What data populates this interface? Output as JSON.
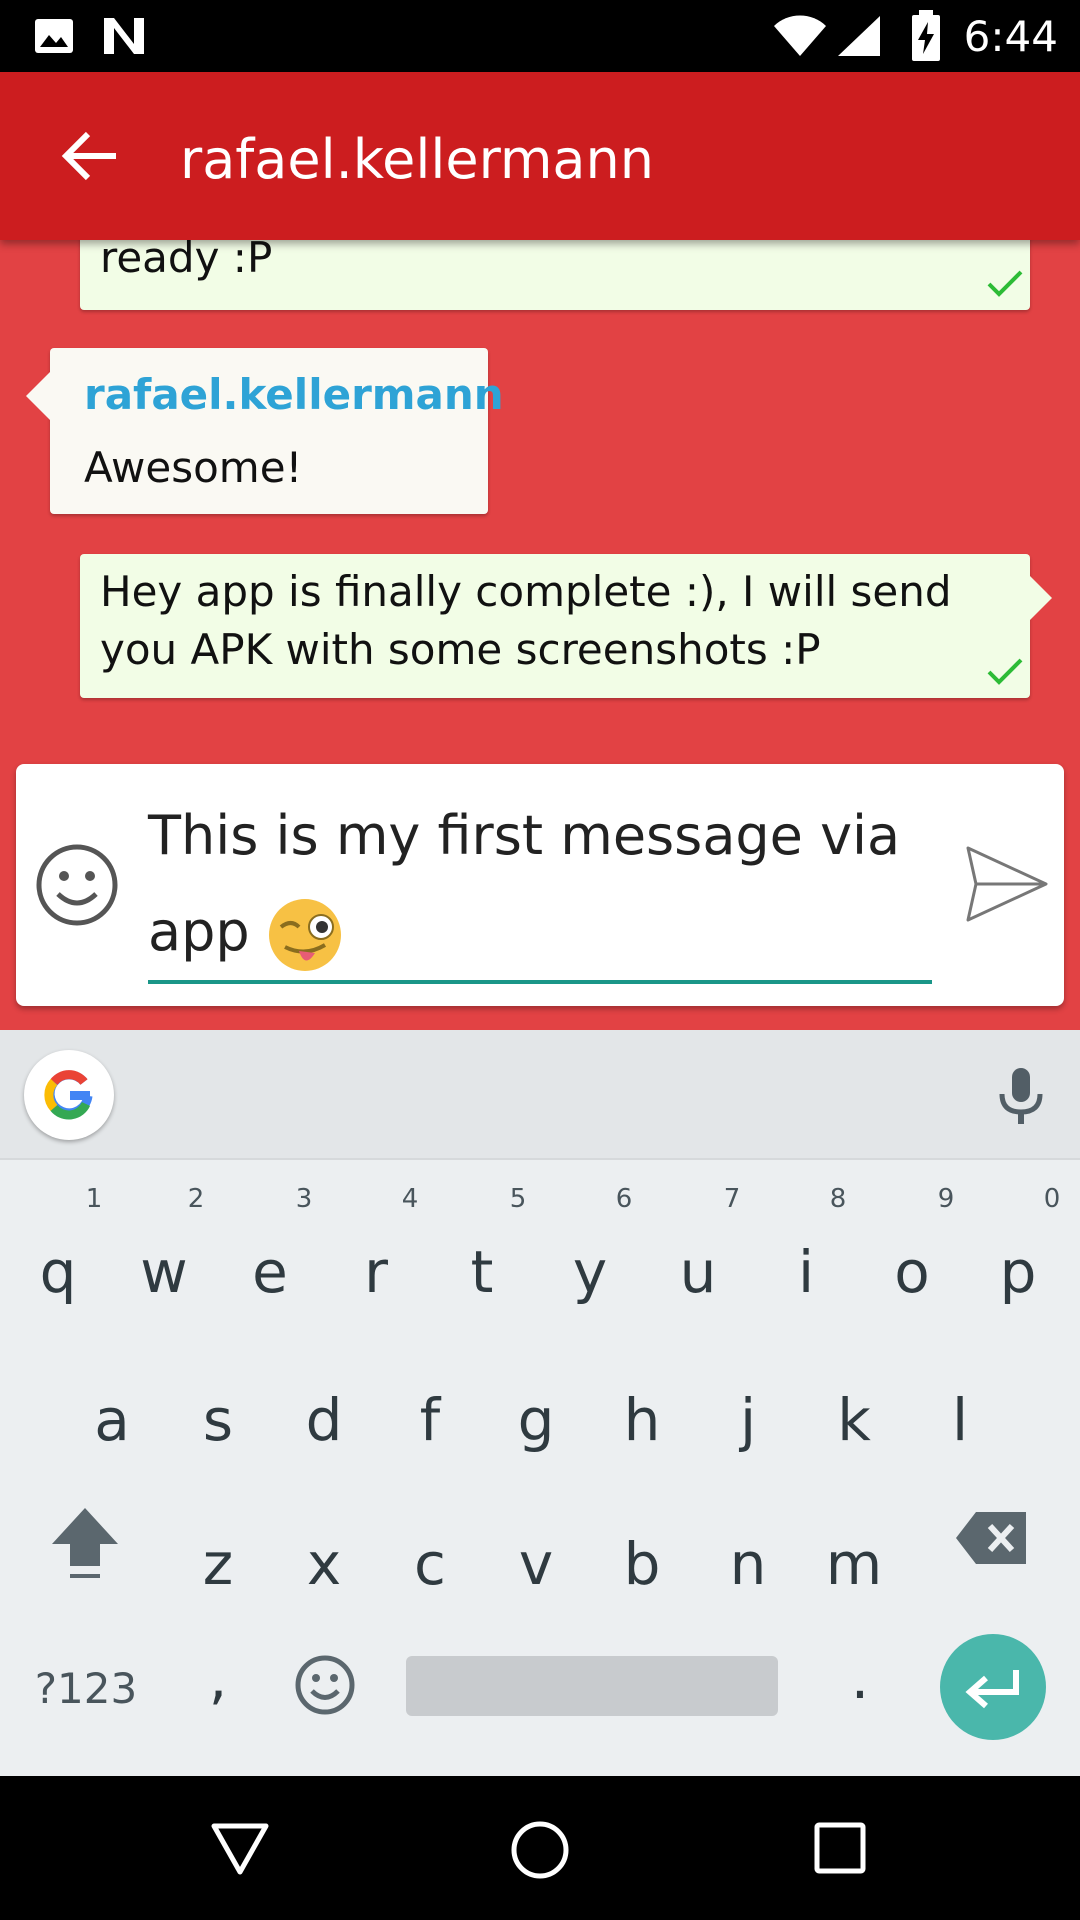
{
  "status_bar": {
    "time": "6:44"
  },
  "toolbar": {
    "title": "rafael.kellermann"
  },
  "messages": [
    {
      "direction": "out",
      "text": "ready :P"
    },
    {
      "direction": "in",
      "sender": "rafael.kellermann",
      "text": "Awesome!"
    },
    {
      "direction": "out",
      "text_line1": "Hey app is finally complete :), I will send",
      "text_line2": "you APK with some screenshots :P"
    }
  ],
  "composer": {
    "text_line1": "This is my first message via",
    "text_line2": "app",
    "emoji": "winking-face-with-tongue"
  },
  "keyboard": {
    "row1": [
      "q",
      "w",
      "e",
      "r",
      "t",
      "y",
      "u",
      "i",
      "o",
      "p"
    ],
    "row1_hints": [
      "1",
      "2",
      "3",
      "4",
      "5",
      "6",
      "7",
      "8",
      "9",
      "0"
    ],
    "row2": [
      "a",
      "s",
      "d",
      "f",
      "g",
      "h",
      "j",
      "k",
      "l"
    ],
    "row3": [
      "z",
      "x",
      "c",
      "v",
      "b",
      "n",
      "m"
    ],
    "symbols_label": "?123",
    "comma": ",",
    "period": "."
  },
  "colors": {
    "accent": "#cc1d1f",
    "chat_bg": "#e24244",
    "sender": "#2ea3d6",
    "input_underline": "#1a9688",
    "enter": "#4ab7ab"
  }
}
